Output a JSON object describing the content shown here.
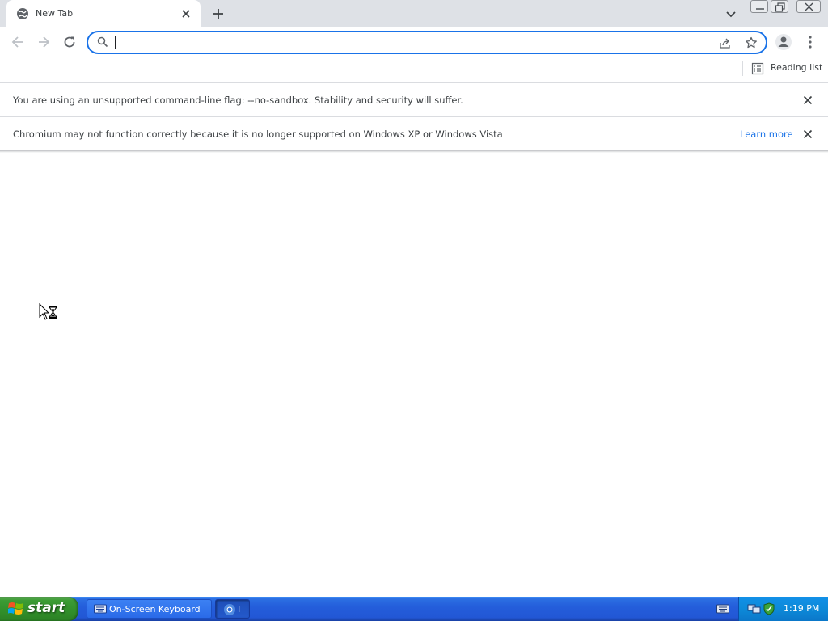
{
  "browser": {
    "tab": {
      "title": "New Tab"
    },
    "omnibox": {
      "value": "",
      "placeholder": ""
    },
    "bookmark_bar": {
      "reading_list_label": "Reading list"
    },
    "infobars": [
      {
        "message": "You are using an unsupported command-line flag: --no-sandbox. Stability and security will suffer."
      },
      {
        "message": "Chromium may not function correctly because it is no longer supported on Windows XP or Windows Vista",
        "link": "Learn more"
      }
    ]
  },
  "taskbar": {
    "start_label": "start",
    "tasks": [
      {
        "label": "On-Screen Keyboard",
        "icon": "keyboard-icon"
      },
      {
        "label": "I",
        "icon": "chromium-icon"
      }
    ],
    "clock": "1:19 PM"
  },
  "colors": {
    "accent": "#1a73e8",
    "tabstrip": "#dee1e6",
    "taskbar": "#245edb",
    "start_button": "#3c9c35"
  }
}
